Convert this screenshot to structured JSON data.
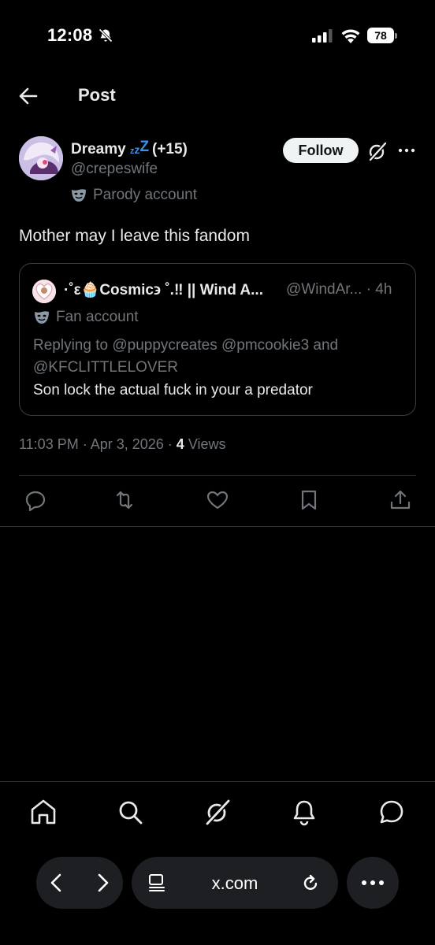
{
  "status_bar": {
    "time": "12:08",
    "battery": "78",
    "icons": [
      "bell-slash-icon",
      "signal-icon",
      "wifi-icon",
      "battery-icon"
    ]
  },
  "header": {
    "title": "Post",
    "back_icon": "arrow-left-icon"
  },
  "post": {
    "author_name": "Dreamy",
    "author_decoration": "zzZ",
    "author_extra": "(+15)",
    "handle": "@crepeswife",
    "account_label": "Parody account",
    "follow_label": "Follow",
    "text": "Mother may I leave this fandom",
    "timestamp": "11:03 PM · Apr 3, 2026 ·",
    "views_count": "4",
    "views_label": "Views"
  },
  "quoted_post": {
    "name": "·˚ε🧁Cosmic϶ ˚.‼ || Wind A...",
    "handle_time": "@WindAr... · 4h",
    "account_label": "Fan account",
    "replying_to": "Replying to @puppycreates @pmcookie3 and @KFCLITTLELOVER",
    "text": "Son lock the actual fuck in your a predator"
  },
  "actions": [
    "reply-icon",
    "repost-icon",
    "like-icon",
    "bookmark-icon",
    "share-icon"
  ],
  "tab_bar": [
    "home-icon",
    "search-icon",
    "grok-icon",
    "notifications-icon",
    "messages-icon"
  ],
  "browser": {
    "url": "x.com"
  },
  "colors": {
    "background": "#000000",
    "text_primary": "#e7e9ea",
    "text_secondary": "#71767b",
    "accent_blue": "#3b91e6",
    "border": "#2f3336",
    "follow_button_bg": "#eff3f4"
  }
}
